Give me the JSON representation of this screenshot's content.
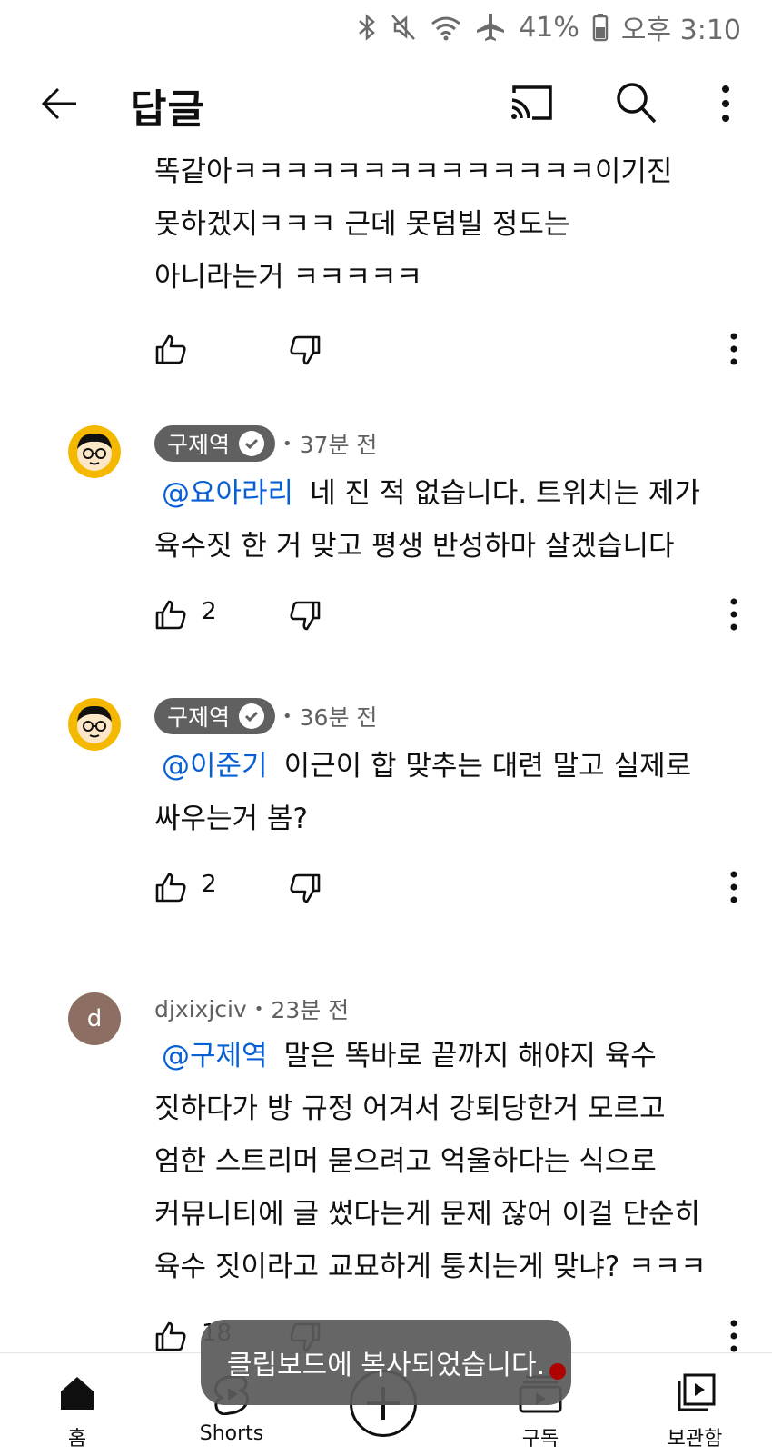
{
  "status": {
    "battery": "41%",
    "time": "오후 3:10"
  },
  "appbar": {
    "title": "답글"
  },
  "comments": [
    {
      "text": "똑같아ㅋㅋㅋㅋㅋㅋㅋㅋㅋㅋㅋㅋㅋㅋ이기진\n못하겠지ㅋㅋㅋ 근데 못덤빌 정도는\n아니라는거 ㅋㅋㅋㅋㅋ",
      "likes": ""
    },
    {
      "author": "구제역",
      "time": "37분 전",
      "mention": "@요아라리",
      "text": "네 진 적 없습니다. 트위치는 제가\n육수짓 한 거 맞고 평생 반성하마 살겠습니다",
      "likes": "2"
    },
    {
      "author": "구제역",
      "time": "36분 전",
      "mention": "@이준기",
      "text": "이근이 합 맞추는 대련 말고 실제로\n싸우는거 봄?",
      "likes": "2"
    },
    {
      "author": "djxixjciv",
      "avatar_letter": "d",
      "time": "23분 전",
      "mention": "@구제역",
      "text": "말은 똑바로 끝까지 해야지 육수\n짓하다가 방 규정 어겨서 강퇴당한거 모르고\n엄한 스트리머 묻으려고 억울하다는 식으로\n커뮤니티에 글 썼다는게 문제 잖어 이걸 단순히\n육수 짓이라고 교묘하게 퉁치는게 맞냐? ㅋㅋㅋ",
      "likes": "18"
    }
  ],
  "toast": "클립보드에 복사되었습니다.",
  "nav": {
    "home": "홈",
    "shorts": "Shorts",
    "subscriptions": "구독",
    "library": "보관함"
  },
  "colors": {
    "mention": "#065fd4",
    "chip": "#606060",
    "avatar_d": "#8d6e63",
    "avatar_yellow": "#f5b800"
  }
}
